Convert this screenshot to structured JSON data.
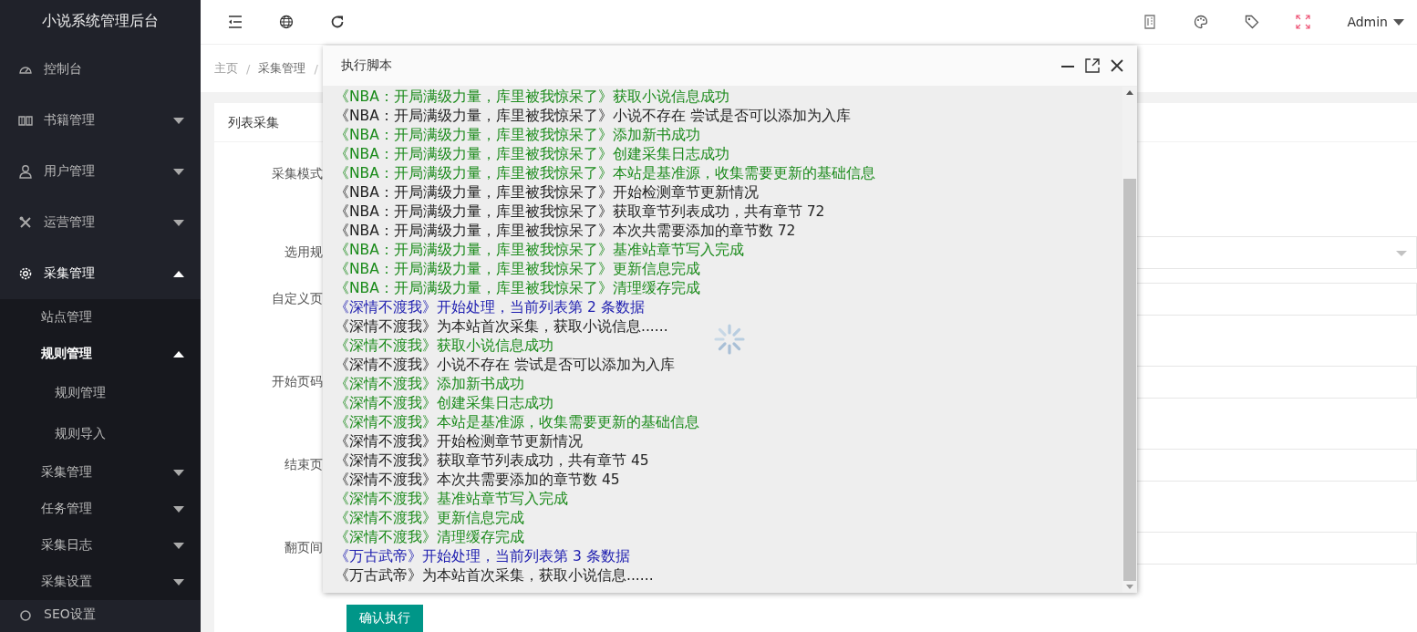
{
  "sidebar": {
    "title": "小说系统管理后台",
    "items": [
      {
        "label": "控制台"
      },
      {
        "label": "书籍管理",
        "expanded": false
      },
      {
        "label": "用户管理",
        "expanded": false
      },
      {
        "label": "运营管理",
        "expanded": false
      },
      {
        "label": "采集管理",
        "expanded": true,
        "children": [
          {
            "label": "站点管理"
          },
          {
            "label": "规则管理",
            "expanded": true,
            "children": [
              {
                "label": "规则管理"
              },
              {
                "label": "规则导入"
              }
            ]
          },
          {
            "label": "采集管理",
            "expanded": false
          },
          {
            "label": "任务管理",
            "expanded": false
          },
          {
            "label": "采集日志",
            "expanded": false
          },
          {
            "label": "采集设置",
            "expanded": false
          }
        ]
      },
      {
        "label": "SEO设置"
      }
    ]
  },
  "header": {
    "user": "Admin"
  },
  "breadcrumb": {
    "items": [
      "主页",
      "采集管理"
    ],
    "separator": "/"
  },
  "card": {
    "title": "列表采集",
    "fields": [
      {
        "label": "采集模式",
        "kind": "none"
      },
      {
        "label": "选用规",
        "kind": "select"
      },
      {
        "label": "自定义页",
        "kind": "input"
      },
      {
        "label": "开始页码",
        "kind": "input"
      },
      {
        "label": "结束页",
        "kind": "input"
      },
      {
        "label": "翻页间",
        "kind": "input"
      }
    ],
    "submit": "确认执行"
  },
  "dialog": {
    "title": "执行脚本",
    "lines": [
      {
        "kind": "success",
        "text": "《NBA：开局满级力量，库里被我惊呆了》获取小说信息成功"
      },
      {
        "kind": "info",
        "text": "《NBA：开局满级力量，库里被我惊呆了》小说不存在 尝试是否可以添加为入库"
      },
      {
        "kind": "success",
        "text": "《NBA：开局满级力量，库里被我惊呆了》添加新书成功"
      },
      {
        "kind": "success",
        "text": "《NBA：开局满级力量，库里被我惊呆了》创建采集日志成功"
      },
      {
        "kind": "success",
        "text": "《NBA：开局满级力量，库里被我惊呆了》本站是基准源，收集需要更新的基础信息"
      },
      {
        "kind": "info",
        "text": "《NBA：开局满级力量，库里被我惊呆了》开始检测章节更新情况"
      },
      {
        "kind": "info",
        "text": "《NBA：开局满级力量，库里被我惊呆了》获取章节列表成功，共有章节 72"
      },
      {
        "kind": "info",
        "text": "《NBA：开局满级力量，库里被我惊呆了》本次共需要添加的章节数 72"
      },
      {
        "kind": "success",
        "text": "《NBA：开局满级力量，库里被我惊呆了》基准站章节写入完成"
      },
      {
        "kind": "success",
        "text": "《NBA：开局满级力量，库里被我惊呆了》更新信息完成"
      },
      {
        "kind": "success",
        "text": "《NBA：开局满级力量，库里被我惊呆了》清理缓存完成"
      },
      {
        "kind": "start",
        "text": "《深情不渡我》开始处理，当前列表第 2 条数据"
      },
      {
        "kind": "info",
        "text": "《深情不渡我》为本站首次采集，获取小说信息......"
      },
      {
        "kind": "success",
        "text": "《深情不渡我》获取小说信息成功"
      },
      {
        "kind": "info",
        "text": "《深情不渡我》小说不存在 尝试是否可以添加为入库"
      },
      {
        "kind": "success",
        "text": "《深情不渡我》添加新书成功"
      },
      {
        "kind": "success",
        "text": "《深情不渡我》创建采集日志成功"
      },
      {
        "kind": "success",
        "text": "《深情不渡我》本站是基准源，收集需要更新的基础信息"
      },
      {
        "kind": "info",
        "text": "《深情不渡我》开始检测章节更新情况"
      },
      {
        "kind": "info",
        "text": "《深情不渡我》获取章节列表成功，共有章节 45"
      },
      {
        "kind": "info",
        "text": "《深情不渡我》本次共需要添加的章节数 45"
      },
      {
        "kind": "success",
        "text": "《深情不渡我》基准站章节写入完成"
      },
      {
        "kind": "success",
        "text": "《深情不渡我》更新信息完成"
      },
      {
        "kind": "success",
        "text": "《深情不渡我》清理缓存完成"
      },
      {
        "kind": "start",
        "text": "《万古武帝》开始处理，当前列表第 3 条数据"
      },
      {
        "kind": "info",
        "text": "《万古武帝》为本站首次采集，获取小说信息......"
      }
    ]
  }
}
